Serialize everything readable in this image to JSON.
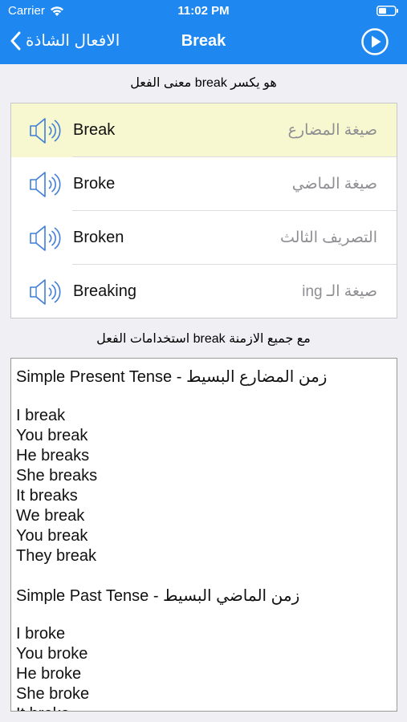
{
  "status_bar": {
    "carrier": "Carrier",
    "time": "11:02 PM"
  },
  "nav": {
    "back_label": "الافعال الشاذة",
    "title": "Break",
    "accent": "#1e87f0"
  },
  "meaning_caption": "معنى الفعل break هو يكسر",
  "forms": [
    {
      "word": "Break",
      "label": "صيغة المضارع",
      "highlighted": true
    },
    {
      "word": "Broke",
      "label": "صيغة الماضي",
      "highlighted": false
    },
    {
      "word": "Broken",
      "label": "التصريف الثالث",
      "highlighted": false
    },
    {
      "word": "Breaking",
      "label": "صيغة الـ ing",
      "highlighted": false
    }
  ],
  "usage_caption": "استخدامات الفعل break مع جميع الازمنة",
  "usage_lines": [
    "Simple Present Tense - زمن المضارع البسيط",
    "",
    "I break",
    "You break",
    "He breaks",
    "She breaks",
    "It breaks",
    "We break",
    "You break",
    "They break",
    "",
    " Simple Past Tense - زمن الماضي البسيط",
    "",
    "I broke",
    "You broke",
    "He broke",
    "She broke",
    "It broke"
  ]
}
